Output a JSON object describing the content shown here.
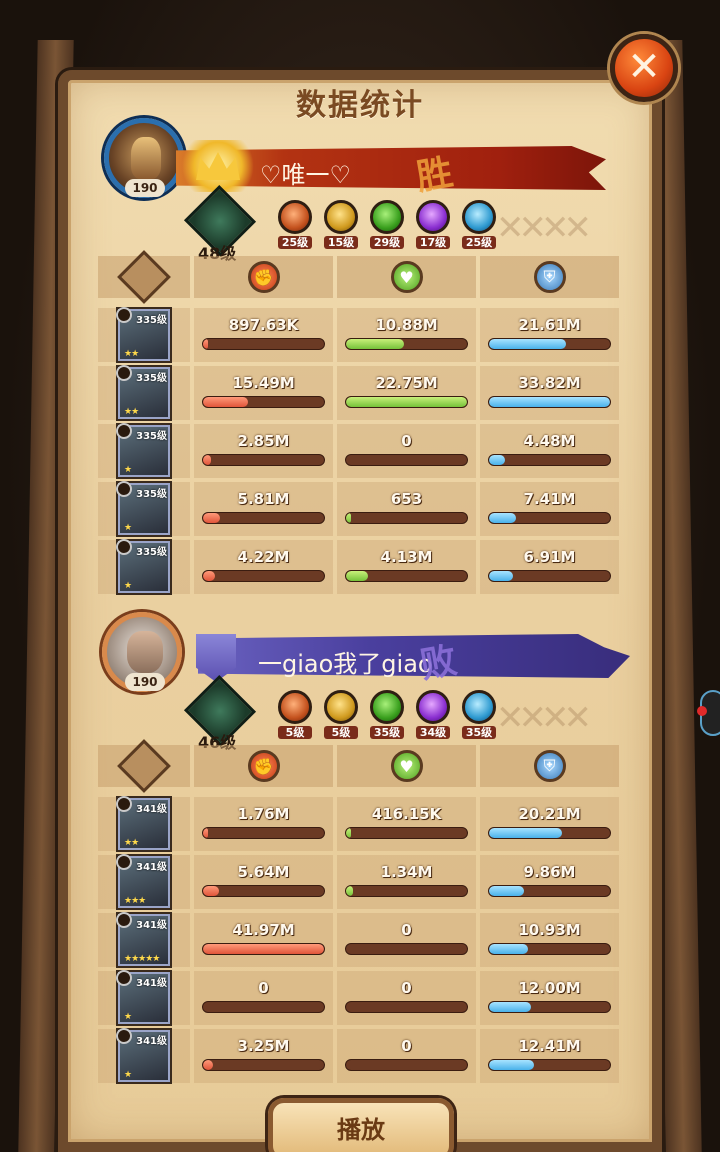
{
  "title": "数据统计",
  "close_glyph": "✕",
  "play_label": "播放",
  "teams": [
    {
      "player_name": "♡唯一♡",
      "result": "胜",
      "avatar_level": "190",
      "tree_level": "48级",
      "factions": [
        {
          "name": "lightbearer",
          "level": "25级",
          "color": "#d0561e"
        },
        {
          "name": "mauler",
          "level": "15级",
          "color": "#d09a1e"
        },
        {
          "name": "wilder",
          "level": "29级",
          "color": "#3aa01e"
        },
        {
          "name": "graveborn",
          "level": "17级",
          "color": "#8a2ed0"
        },
        {
          "name": "celestial",
          "level": "25级",
          "color": "#2e9ad0"
        }
      ],
      "rows": [
        {
          "hero_level": "335级",
          "stars": "★★",
          "damage": "897.63K",
          "heal": "10.88M",
          "shield": "21.61M",
          "damage_frac": 0.03,
          "heal_frac": 0.48,
          "shield_frac": 0.64
        },
        {
          "hero_level": "335级",
          "stars": "★★",
          "damage": "15.49M",
          "heal": "22.75M",
          "shield": "33.82M",
          "damage_frac": 0.37,
          "heal_frac": 1.0,
          "shield_frac": 1.0
        },
        {
          "hero_level": "335级",
          "stars": "★",
          "damage": "2.85M",
          "heal": "0",
          "shield": "4.48M",
          "damage_frac": 0.07,
          "heal_frac": 0.0,
          "shield_frac": 0.13
        },
        {
          "hero_level": "335级",
          "stars": "★",
          "damage": "5.81M",
          "heal": "653",
          "shield": "7.41M",
          "damage_frac": 0.14,
          "heal_frac": 0.01,
          "shield_frac": 0.22
        },
        {
          "hero_level": "335级",
          "stars": "★",
          "damage": "4.22M",
          "heal": "4.13M",
          "shield": "6.91M",
          "damage_frac": 0.1,
          "heal_frac": 0.18,
          "shield_frac": 0.2
        }
      ]
    },
    {
      "player_name": "一giao我了giao",
      "result": "败",
      "avatar_level": "190",
      "tree_level": "46级",
      "factions": [
        {
          "name": "lightbearer",
          "level": "5级",
          "color": "#d0561e"
        },
        {
          "name": "mauler",
          "level": "5级",
          "color": "#d09a1e"
        },
        {
          "name": "wilder",
          "level": "35级",
          "color": "#3aa01e"
        },
        {
          "name": "graveborn",
          "level": "34级",
          "color": "#8a2ed0"
        },
        {
          "name": "celestial",
          "level": "35级",
          "color": "#2e9ad0"
        }
      ],
      "rows": [
        {
          "hero_level": "341级",
          "stars": "★★",
          "damage": "1.76M",
          "heal": "416.15K",
          "shield": "20.21M",
          "damage_frac": 0.04,
          "heal_frac": 0.02,
          "shield_frac": 0.6
        },
        {
          "hero_level": "341级",
          "stars": "★★★",
          "damage": "5.64M",
          "heal": "1.34M",
          "shield": "9.86M",
          "damage_frac": 0.13,
          "heal_frac": 0.06,
          "shield_frac": 0.29
        },
        {
          "hero_level": "341级",
          "stars": "★★★★★",
          "damage": "41.97M",
          "heal": "0",
          "shield": "10.93M",
          "damage_frac": 1.0,
          "heal_frac": 0.0,
          "shield_frac": 0.32
        },
        {
          "hero_level": "341级",
          "stars": "★",
          "damage": "0",
          "heal": "0",
          "shield": "12.00M",
          "damage_frac": 0.0,
          "heal_frac": 0.0,
          "shield_frac": 0.35
        },
        {
          "hero_level": "341级",
          "stars": "★",
          "damage": "3.25M",
          "heal": "0",
          "shield": "12.41M",
          "damage_frac": 0.08,
          "heal_frac": 0.0,
          "shield_frac": 0.37
        }
      ]
    }
  ]
}
